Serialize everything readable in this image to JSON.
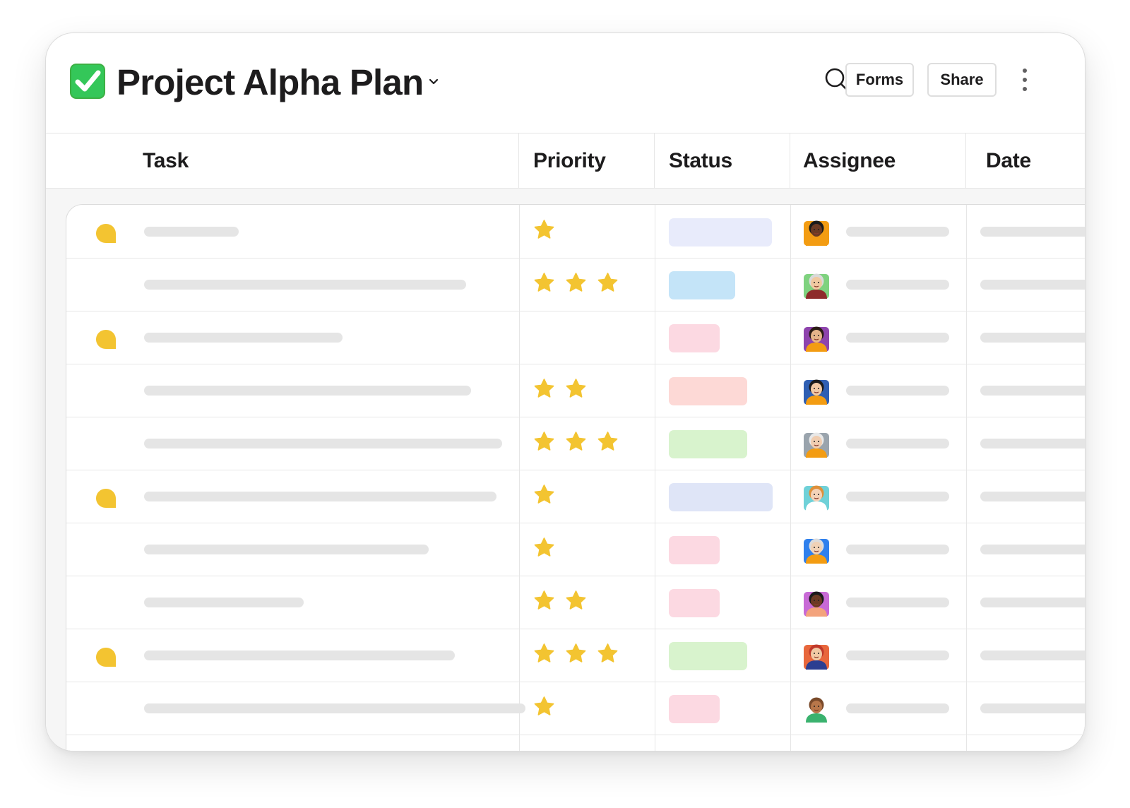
{
  "header": {
    "title": "Project Alpha Plan",
    "forms_label": "Forms",
    "share_label": "Share",
    "icons": [
      "check-mark-emoji",
      "chevron-down-icon",
      "search-icon",
      "more-vertical-icon"
    ]
  },
  "columns": [
    "Task",
    "Priority",
    "Status",
    "Assignee",
    "Date"
  ],
  "colors": {
    "star": "#f3c431",
    "comment_bubble": "#f3c431",
    "check_green": "#34c759"
  },
  "rows": [
    {
      "has_comment": true,
      "stars": 1,
      "status_color": "#e8ebfb"
    },
    {
      "has_comment": false,
      "stars": 3,
      "status_color": "#c4e4f8"
    },
    {
      "has_comment": true,
      "stars": 0,
      "status_color": "#fcd9e2"
    },
    {
      "has_comment": false,
      "stars": 2,
      "status_color": "#fdd9d6"
    },
    {
      "has_comment": false,
      "stars": 3,
      "status_color": "#d8f3cd"
    },
    {
      "has_comment": true,
      "stars": 1,
      "status_color": "#dfe5f7"
    },
    {
      "has_comment": false,
      "stars": 1,
      "status_color": "#fcd9e2"
    },
    {
      "has_comment": false,
      "stars": 2,
      "status_color": "#fcd9e2"
    },
    {
      "has_comment": true,
      "stars": 3,
      "status_color": "#d8f3cd"
    },
    {
      "has_comment": false,
      "stars": 1,
      "status_color": "#fcd9e2"
    }
  ]
}
